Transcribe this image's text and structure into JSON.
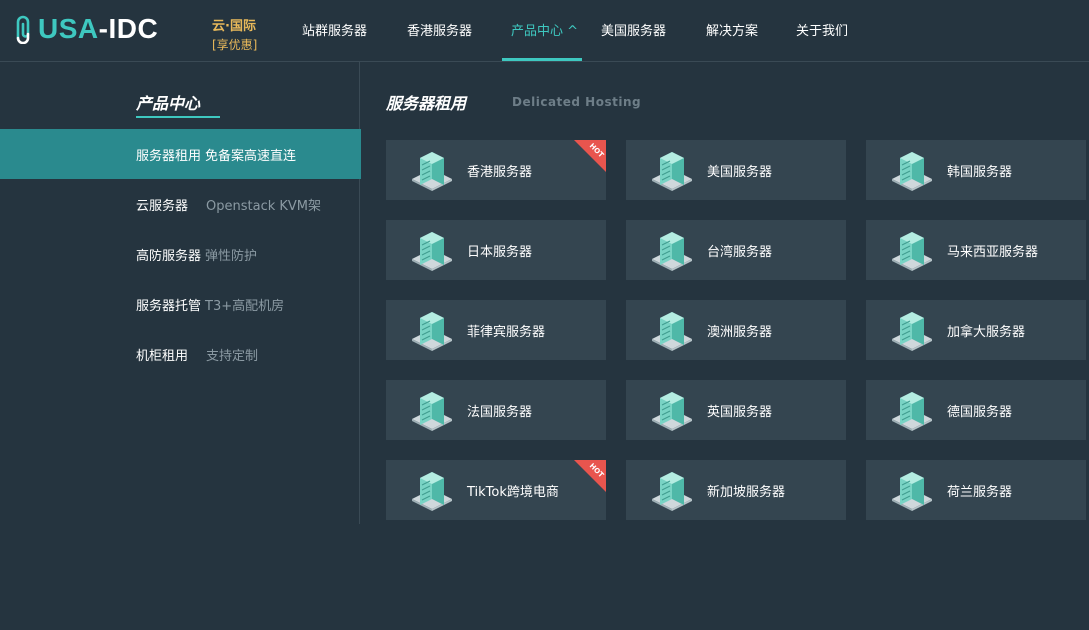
{
  "header": {
    "logo_text_a": "USA",
    "logo_text_b": "-IDC",
    "promo_line1": "云·国际",
    "promo_line2": "[享优惠]",
    "nav": [
      {
        "label": "站群服务器"
      },
      {
        "label": "香港服务器"
      },
      {
        "label": "产品中心 ^"
      },
      {
        "label": "美国服务器"
      },
      {
        "label": "解决方案"
      },
      {
        "label": "关于我们"
      }
    ]
  },
  "sidebar": {
    "title": "产品中心",
    "items": [
      {
        "label": "服务器租用",
        "desc": "免备案高速直连"
      },
      {
        "label": "云服务器",
        "desc": "Openstack KVM架"
      },
      {
        "label": "高防服务器",
        "desc": "弹性防护"
      },
      {
        "label": "服务器托管",
        "desc": "T3+高配机房"
      },
      {
        "label": "机柜租用",
        "desc": "支持定制"
      }
    ]
  },
  "content": {
    "title": "服务器租用",
    "subtitle": "Delicated Hosting",
    "hot_label": "HOT",
    "cards": [
      {
        "label": "香港服务器",
        "hot": true
      },
      {
        "label": "美国服务器",
        "hot": false
      },
      {
        "label": "韩国服务器",
        "hot": false
      },
      {
        "label": "日本服务器",
        "hot": false
      },
      {
        "label": "台湾服务器",
        "hot": false
      },
      {
        "label": "马来西亚服务器",
        "hot": false
      },
      {
        "label": "菲律宾服务器",
        "hot": false
      },
      {
        "label": "澳洲服务器",
        "hot": false
      },
      {
        "label": "加拿大服务器",
        "hot": false
      },
      {
        "label": "法国服务器",
        "hot": false
      },
      {
        "label": "英国服务器",
        "hot": false
      },
      {
        "label": "德国服务器",
        "hot": false
      },
      {
        "label": "TikTok跨境电商",
        "hot": true
      },
      {
        "label": "新加坡服务器",
        "hot": false
      },
      {
        "label": "荷兰服务器",
        "hot": false
      }
    ]
  },
  "colors": {
    "background": "#25343f",
    "accent": "#3ec8c0",
    "active_menu": "#2a8a8e",
    "card": "#344550",
    "promo": "#e9b95a",
    "hot_badge": "#e8554e"
  },
  "icons": {
    "server": "server-icon",
    "hot": "hot-badge-icon",
    "logo": "paperclip-logo-icon"
  }
}
